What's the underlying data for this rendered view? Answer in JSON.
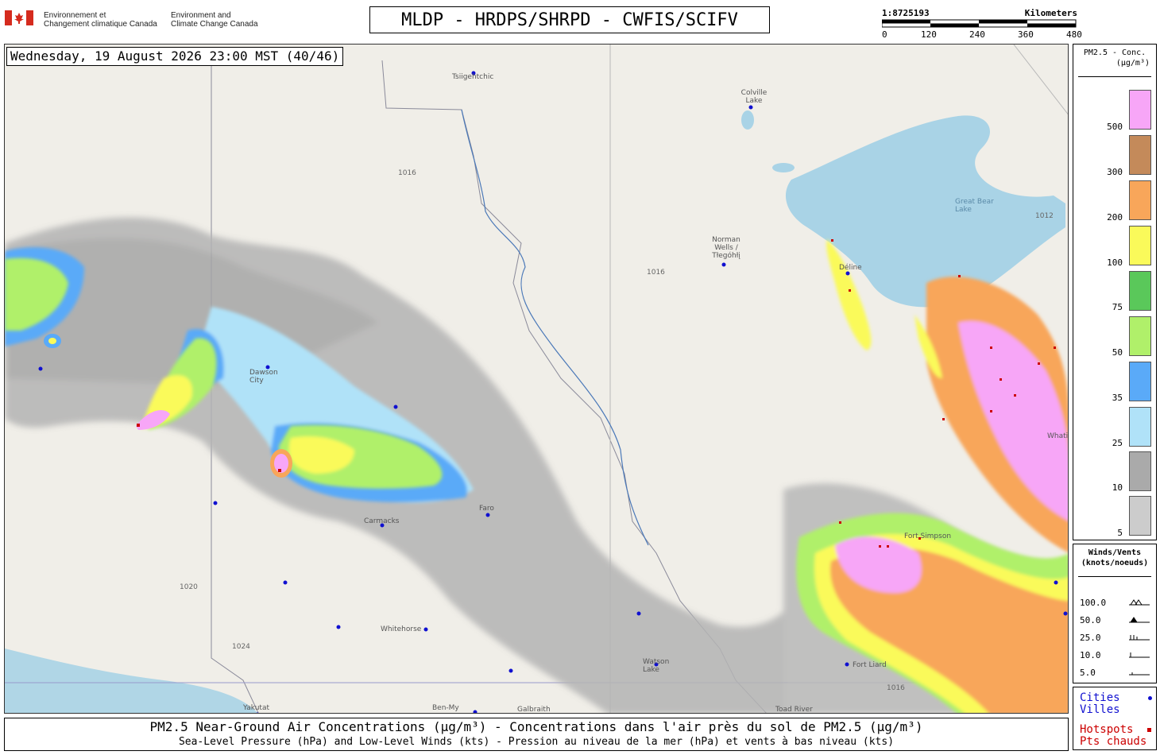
{
  "header": {
    "org_fr": [
      "Environnement et",
      "Changement climatique Canada"
    ],
    "org_en": [
      "Environment and",
      "Climate Change Canada"
    ],
    "title": "MLDP - HRDPS/SHRPD - CWFIS/SCIFV",
    "scale": {
      "ratio": "1:8725193",
      "unit": "Kilometers",
      "ticks": [
        "0",
        "120",
        "240",
        "360",
        "480"
      ]
    }
  },
  "map": {
    "timestamp": "Wednesday, 19 August 2026 23:00 MST (40/46)",
    "places": [
      "Tsiigehtchic",
      "Colville Lake",
      "Norman Wells / Tłegóhłį",
      "Déline",
      "Great Bear Lake",
      "Dawson City",
      "Carmacks",
      "Faro",
      "Whitehorse",
      "Watson Lake",
      "Fort Liard",
      "Toad River",
      "Yakutat",
      "Ben-My",
      "Galbraith",
      "Whati",
      "Fort Simpson"
    ],
    "isobars": [
      "1016",
      "1012",
      "1020",
      "1024"
    ],
    "colors": {
      "pink": "#f7a6f7",
      "brown": "#c48a5a",
      "orange": "#f8a65a",
      "yellow": "#fafa5a",
      "green": "#5ac85a",
      "lightgreen": "#b0f06a",
      "blue": "#5aaaf8",
      "lightblue": "#b0e2f8",
      "gray": "#aaaaaa",
      "lightgray": "#cccccc",
      "hotspot": "#cc0000",
      "water": "#a9d3e6"
    }
  },
  "legend": {
    "title": [
      "PM2.5 - Conc.",
      "(µg/m³)"
    ],
    "bins": [
      "500",
      "300",
      "200",
      "100",
      "75",
      "50",
      "35",
      "25",
      "10",
      "5"
    ]
  },
  "wind_legend": {
    "title": [
      "Winds/Vents",
      "(knots/noeuds)"
    ],
    "values": [
      "100.0",
      "50.0",
      "25.0",
      "10.0",
      "5.0"
    ]
  },
  "key_legend": {
    "cities": [
      "Cities",
      "Villes"
    ],
    "hotspots": [
      "Hotspots",
      "Pts chauds"
    ]
  },
  "footer": {
    "line1": "PM2.5 Near-Ground Air Concentrations (µg/m³) - Concentrations dans l'air près du sol de PM2.5 (µg/m³)",
    "line2": "Sea-Level Pressure (hPa) and Low-Level Winds (kts) - Pression au niveau de la mer (hPa) et vents à bas niveau (kts)"
  }
}
